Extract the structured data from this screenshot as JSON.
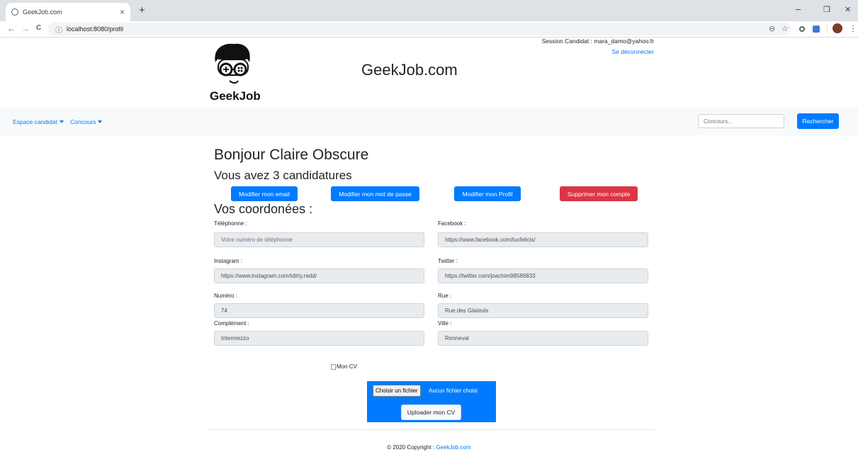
{
  "browser": {
    "tab_title": "GeekJob.com",
    "tab_close": "×",
    "new_tab": "+",
    "url": "localhost:8080/profil",
    "win_min": "–",
    "win_max": "❐",
    "win_close": "✕",
    "back": "←",
    "forward": "→",
    "reload": "C",
    "info": "ⓘ",
    "zoom": "⊖",
    "star": "☆",
    "menu": "⋮"
  },
  "header": {
    "logo_text": "GeekJob",
    "site_title": "GeekJob.com",
    "session_text": "Session Candidat : mara_damo@yahoo.fr",
    "logout_label": "Se déconnecter"
  },
  "navbar": {
    "espace_candidat": "Espace candidat",
    "concours": "Concours",
    "search_placeholder": "Concours...",
    "search_button": "Rechercher"
  },
  "main": {
    "greeting": "Bonjour Claire Obscure",
    "applications": "Vous avez 3 candidatures",
    "buttons": {
      "email": "Modifier mon email",
      "password": "Modifier mon mot de passe",
      "profile": "Modifier mon Profil",
      "delete": "Supprimer mon compte"
    },
    "coords_title": "Vos coordonées :",
    "fields": {
      "telephone": {
        "label": "Téléphonne :",
        "value": "",
        "placeholder": "Votre numéro de téléphonne"
      },
      "facebook": {
        "label": "Facebook :",
        "value": "https://www.facebook.com/luxfelicis/"
      },
      "instagram": {
        "label": "Instagram :",
        "value": "https://www.instagram.com/tdirty.redd/"
      },
      "twitter": {
        "label": "Twitter :",
        "value": "https://twitter.com/joachim98586833"
      },
      "numero": {
        "label": "Numéro :",
        "value": "74"
      },
      "rue": {
        "label": "Rue :",
        "value": "Rue des Glaïeuls"
      },
      "complement": {
        "label": "Complément :",
        "value": "Intermezzo"
      },
      "ville": {
        "label": "Ville :",
        "value": "Renneval"
      }
    },
    "cv_alt": "Mon CV",
    "file_button": "Choisir un fichier",
    "file_status": "Aucun fichier choisi",
    "upload_button": "Uploader mon CV"
  },
  "footer": {
    "copyright": "© 2020 Copyright : ",
    "link": "GeekJob.com"
  }
}
